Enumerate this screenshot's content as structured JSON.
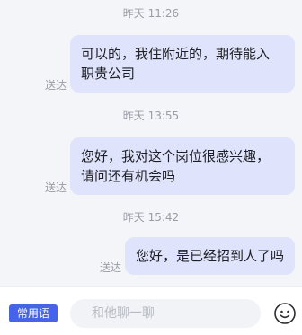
{
  "messages": [
    {
      "time": "昨天 11:26",
      "status": "送达",
      "lines": [
        "可以的，我住附近的，期待能入",
        "职贵公司"
      ]
    },
    {
      "time": "昨天 13:55",
      "status": "送达",
      "lines": [
        "您好，我对这个岗位很感兴趣，",
        "请问还有机会吗"
      ]
    },
    {
      "time": "昨天 15:42",
      "status": "送达",
      "lines": [
        "您好，是已经招到人了吗"
      ]
    }
  ],
  "bottom_bar": {
    "phrases_label": "常用语",
    "input_placeholder": "和他聊一聊",
    "input_value": "",
    "emoji_icon": "emoji-face-icon"
  },
  "colors": {
    "background": "#f4f5f9",
    "bubble": "#dfe3fb",
    "accent": "#4565e6",
    "meta_text": "#9a9da6"
  }
}
